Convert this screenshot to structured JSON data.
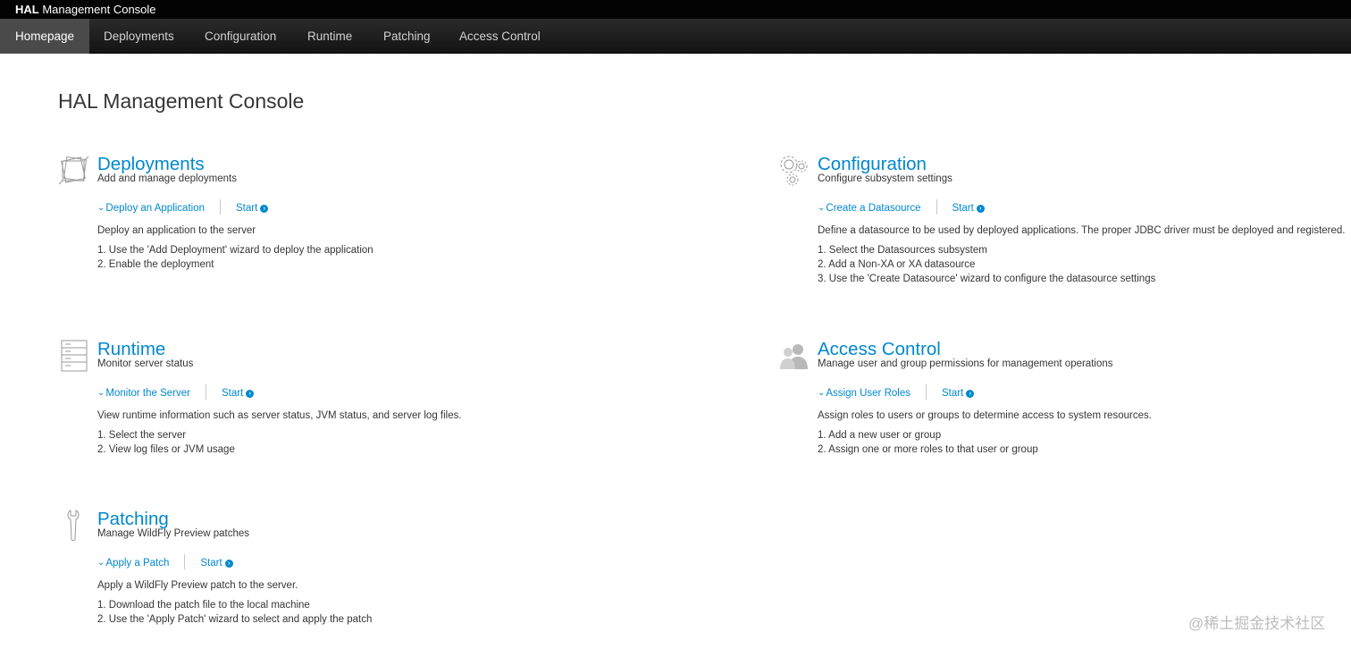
{
  "app": {
    "brand_strong": "HAL",
    "brand_rest": " Management Console"
  },
  "nav": {
    "items": [
      {
        "label": "Homepage",
        "active": true
      },
      {
        "label": "Deployments",
        "active": false
      },
      {
        "label": "Configuration",
        "active": false
      },
      {
        "label": "Runtime",
        "active": false
      },
      {
        "label": "Patching",
        "active": false
      },
      {
        "label": "Access Control",
        "active": false
      }
    ]
  },
  "page": {
    "title": "HAL Management Console"
  },
  "modules": {
    "deployments": {
      "icon": "deployments-icon",
      "title": "Deployments",
      "subtitle": "Add and manage deployments",
      "task": "Deploy an Application",
      "start": "Start",
      "description": "Deploy an application to the server",
      "steps": [
        "1. Use the 'Add Deployment' wizard to deploy the application",
        "2. Enable the deployment"
      ]
    },
    "configuration": {
      "icon": "gears-icon",
      "title": "Configuration",
      "subtitle": "Configure subsystem settings",
      "task": "Create a Datasource",
      "start": "Start",
      "description": "Define a datasource to be used by deployed applications. The proper JDBC driver must be deployed and registered.",
      "steps": [
        "1. Select the Datasources subsystem",
        "2. Add a Non-XA or XA datasource",
        "3. Use the 'Create Datasource' wizard to configure the datasource settings"
      ]
    },
    "runtime": {
      "icon": "server-icon",
      "title": "Runtime",
      "subtitle": "Monitor server status",
      "task": "Monitor the Server",
      "start": "Start",
      "description": "View runtime information such as server status, JVM status, and server log files.",
      "steps": [
        "1. Select the server",
        "2. View log files or JVM usage"
      ]
    },
    "access_control": {
      "icon": "users-icon",
      "title": "Access Control",
      "subtitle": "Manage user and group permissions for management operations",
      "task": "Assign User Roles",
      "start": "Start",
      "description": "Assign roles to users or groups to determine access to system resources.",
      "steps": [
        "1. Add a new user or group",
        "2. Assign one or more roles to that user or group"
      ]
    },
    "patching": {
      "icon": "wrench-icon",
      "title": "Patching",
      "subtitle": "Manage WildFly Preview patches",
      "task": "Apply a Patch",
      "start": "Start",
      "description": "Apply a WildFly Preview patch to the server.",
      "steps": [
        "1. Download the patch file to the local machine",
        "2. Use the 'Apply Patch' wizard to select and apply the patch"
      ]
    }
  },
  "watermark": "@稀土掘金技术社区",
  "colors": {
    "accent": "#0088ce",
    "topbar": "#030303",
    "navbar": "#1c1c1c",
    "nav_active": "#4a4a4a"
  }
}
